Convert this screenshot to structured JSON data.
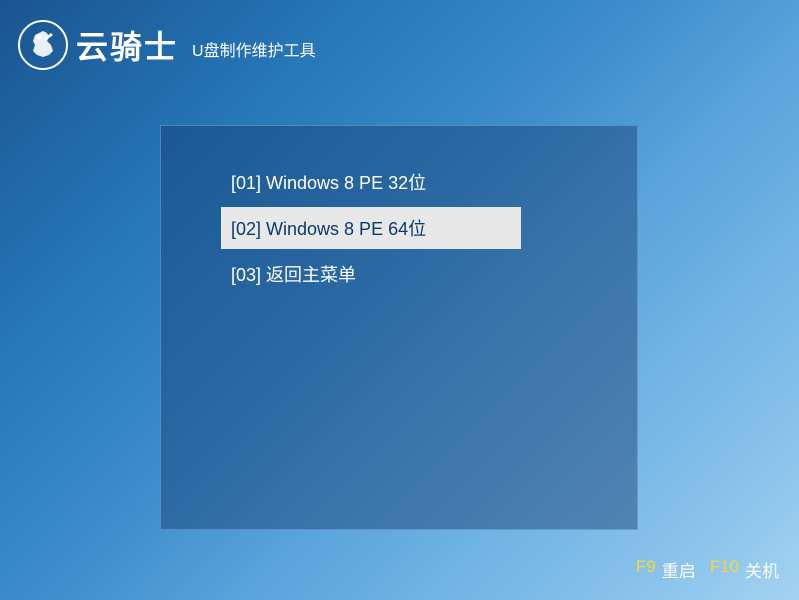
{
  "header": {
    "brand": "云骑士",
    "subtitle": "U盘制作维护工具"
  },
  "menu": {
    "items": [
      {
        "label": "[01] Windows 8 PE 32位",
        "selected": false
      },
      {
        "label": "[02] Windows 8 PE 64位",
        "selected": true
      },
      {
        "label": "[03] 返回主菜单",
        "selected": false
      }
    ]
  },
  "footer": {
    "restart_key": "F9",
    "restart_label": "重启",
    "shutdown_key": "F10",
    "shutdown_label": "关机"
  }
}
